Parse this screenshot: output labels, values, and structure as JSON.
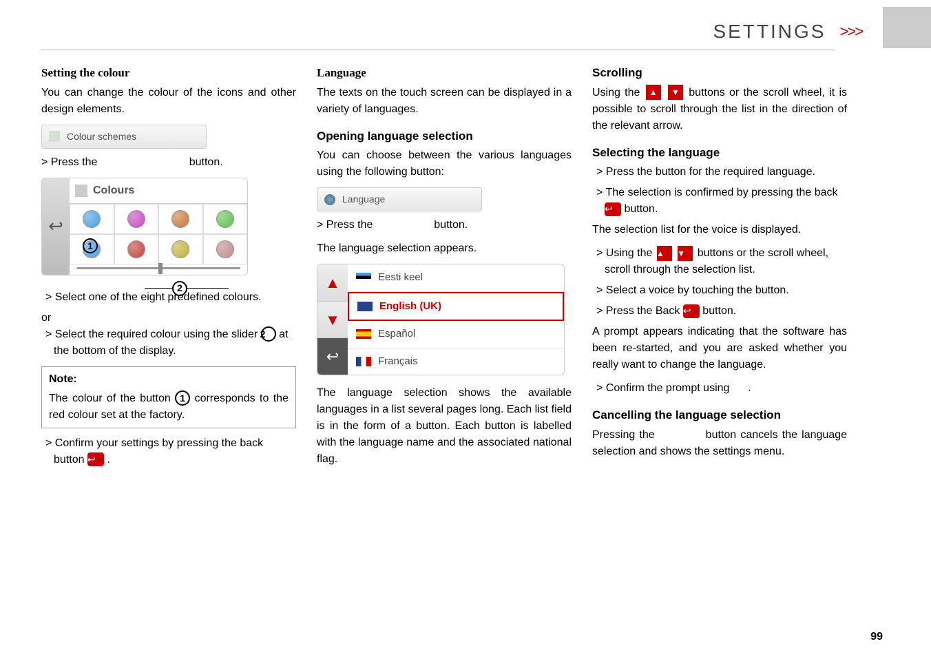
{
  "header": {
    "title": "SETTINGS",
    "chevrons": ">>>"
  },
  "col1": {
    "h1": "Setting the colour",
    "p1": "You can change the colour of the icons and other design elements.",
    "btn_colour_schemes": "Colour schemes",
    "press_prefix": "> Press the",
    "press_suffix": "button.",
    "panel_title": "Colours",
    "callout1": "1",
    "callout2": "2",
    "li1": "> Select one of the eight predefined colours.",
    "or": "or",
    "li2a": "> Select the required colour using the slider ",
    "li2b": " at the bottom of the display.",
    "note_label": "Note:",
    "note_a": "The colour of the button ",
    "note_b": " corresponds to the red colour set at the factory.",
    "li3": "> Confirm your settings by pressing the back button ",
    "li3b": " ."
  },
  "col2": {
    "h1": "Language",
    "p1": "The texts on the touch screen can be displayed in a variety of languages.",
    "h2": "Opening language selection",
    "p2": "You can choose between the various languages using the following button:",
    "btn_language": "Language",
    "press_prefix": "> Press the",
    "press_suffix": "button.",
    "p3": "The language selection appears.",
    "lang0": "Eesti keel",
    "lang1": "English (UK)",
    "lang2": "Español",
    "lang3": "Français",
    "p4": "The language selection shows the available languages in a list several pages long. Each list field is in the form of a button. Each button is labelled with the language name and the associated national flag."
  },
  "col3": {
    "h1": "Scrolling",
    "p1a": "Using the ",
    "p1b": " buttons or the scroll wheel, it is possible to scroll through the list in the direction of the relevant arrow.",
    "h2": "Selecting the language",
    "li1": "> Press the button for the required language.",
    "li2a": "> The selection is confirmed by pressing the back ",
    "li2b": " button.",
    "p2": "The selection list for the voice is displayed.",
    "li3a": "> Using the ",
    "li3b": " buttons or the scroll wheel, scroll through the selection list.",
    "li4": "> Select a voice by touching the button.",
    "li5a": "> Press the Back ",
    "li5b": " button.",
    "p3": "A prompt appears indicating that the software has been re-started, and you are asked whether you really want to change the language.",
    "li6": "> Confirm the prompt using ",
    "li6b": ".",
    "h3": "Cancelling the language selection",
    "p4a": "Pressing the ",
    "p4b": " button cancels the language selection and shows the settings menu."
  },
  "page_number": "99"
}
